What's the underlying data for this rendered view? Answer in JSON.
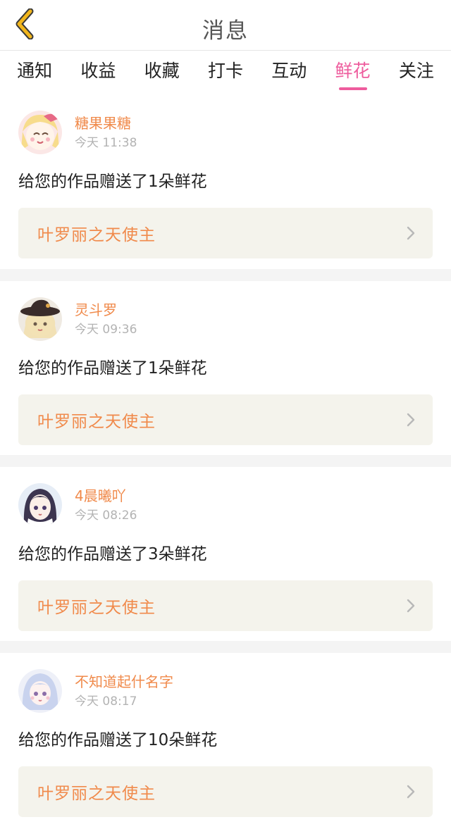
{
  "header": {
    "title": "消息",
    "back_icon": "chevron-left-icon",
    "back_color": "#f2b61c"
  },
  "tabs": [
    {
      "label": "通知",
      "active": false
    },
    {
      "label": "收益",
      "active": false
    },
    {
      "label": "收藏",
      "active": false
    },
    {
      "label": "打卡",
      "active": false
    },
    {
      "label": "互动",
      "active": false
    },
    {
      "label": "鲜花",
      "active": true
    },
    {
      "label": "关注",
      "active": false
    }
  ],
  "accent_color": "#ee5c9d",
  "name_color": "#f08a4b",
  "items": [
    {
      "username": "糖果果糖",
      "time": "今天 11:38",
      "message": "给您的作品赠送了1朵鲜花",
      "work_title": "叶罗丽之天使主"
    },
    {
      "username": "灵斗罗",
      "time": "今天 09:36",
      "message": "给您的作品赠送了1朵鲜花",
      "work_title": "叶罗丽之天使主"
    },
    {
      "username": "4晨曦吖",
      "time": "今天 08:26",
      "message": "给您的作品赠送了3朵鲜花",
      "work_title": "叶罗丽之天使主"
    },
    {
      "username": "不知道起什名字",
      "time": "今天 08:17",
      "message": "给您的作品赠送了10朵鲜花",
      "work_title": "叶罗丽之天使主"
    }
  ]
}
